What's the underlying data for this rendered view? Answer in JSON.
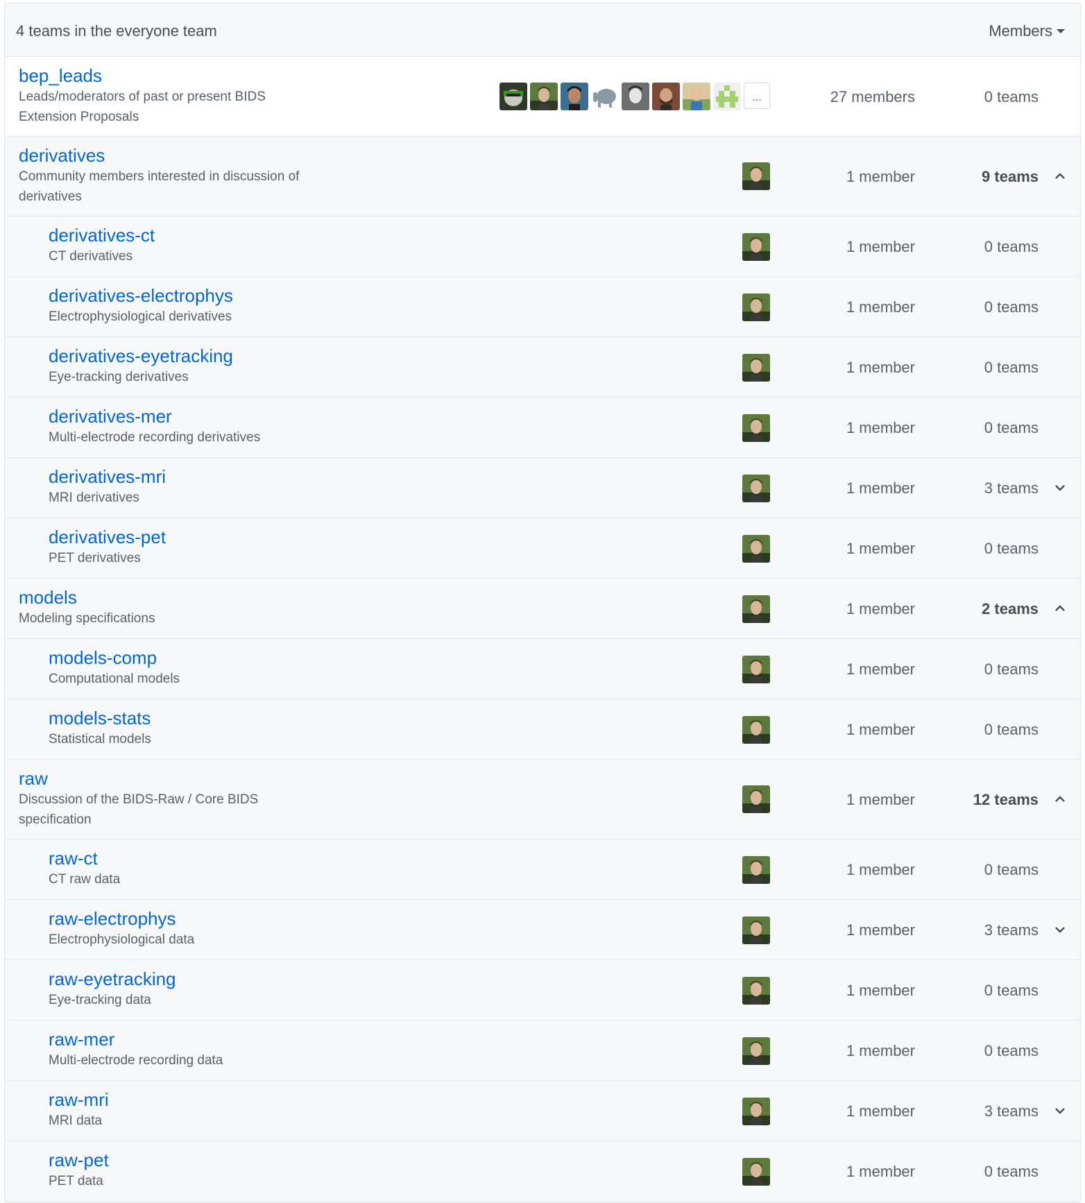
{
  "header": {
    "title": "4 teams in the everyone team",
    "members_menu": "Members"
  },
  "teams": [
    {
      "name": "bep_leads",
      "desc": "Leads/moderators of past or present BIDS Extension Proposals",
      "members": "27 members",
      "teams": "0 teams"
    },
    {
      "name": "derivatives",
      "desc": "Community members interested in discussion of derivatives",
      "members": "1 member",
      "teams": "9 teams"
    },
    {
      "name": "derivatives-ct",
      "desc": "CT derivatives",
      "members": "1 member",
      "teams": "0 teams"
    },
    {
      "name": "derivatives-electrophys",
      "desc": "Electrophysiological derivatives",
      "members": "1 member",
      "teams": "0 teams"
    },
    {
      "name": "derivatives-eyetracking",
      "desc": "Eye-tracking derivatives",
      "members": "1 member",
      "teams": "0 teams"
    },
    {
      "name": "derivatives-mer",
      "desc": "Multi-electrode recording derivatives",
      "members": "1 member",
      "teams": "0 teams"
    },
    {
      "name": "derivatives-mri",
      "desc": "MRI derivatives",
      "members": "1 member",
      "teams": "3 teams"
    },
    {
      "name": "derivatives-pet",
      "desc": "PET derivatives",
      "members": "1 member",
      "teams": "0 teams"
    },
    {
      "name": "models",
      "desc": "Modeling specifications",
      "members": "1 member",
      "teams": "2 teams"
    },
    {
      "name": "models-comp",
      "desc": "Computational models",
      "members": "1 member",
      "teams": "0 teams"
    },
    {
      "name": "models-stats",
      "desc": "Statistical models",
      "members": "1 member",
      "teams": "0 teams"
    },
    {
      "name": "raw",
      "desc": "Discussion of the BIDS-Raw / Core BIDS specification",
      "members": "1 member",
      "teams": "12 teams"
    },
    {
      "name": "raw-ct",
      "desc": "CT raw data",
      "members": "1 member",
      "teams": "0 teams"
    },
    {
      "name": "raw-electrophys",
      "desc": "Electrophysiological data",
      "members": "1 member",
      "teams": "3 teams"
    },
    {
      "name": "raw-eyetracking",
      "desc": "Eye-tracking data",
      "members": "1 member",
      "teams": "0 teams"
    },
    {
      "name": "raw-mer",
      "desc": "Multi-electrode recording data",
      "members": "1 member",
      "teams": "0 teams"
    },
    {
      "name": "raw-mri",
      "desc": "MRI data",
      "members": "1 member",
      "teams": "3 teams"
    },
    {
      "name": "raw-pet",
      "desc": "PET data",
      "members": "1 member",
      "teams": "0 teams"
    }
  ],
  "more_avatars_label": "...",
  "colors": {
    "link": "#0366d6",
    "muted_text": "#586069",
    "dark_text": "#444d56",
    "border": "#e1e4e8",
    "row_bg_alt": "#f6f8fa"
  },
  "icons": {
    "members_dropdown": "caret-down-icon",
    "expanded": "chevron-up-icon",
    "collapsed": "chevron-down-icon"
  }
}
